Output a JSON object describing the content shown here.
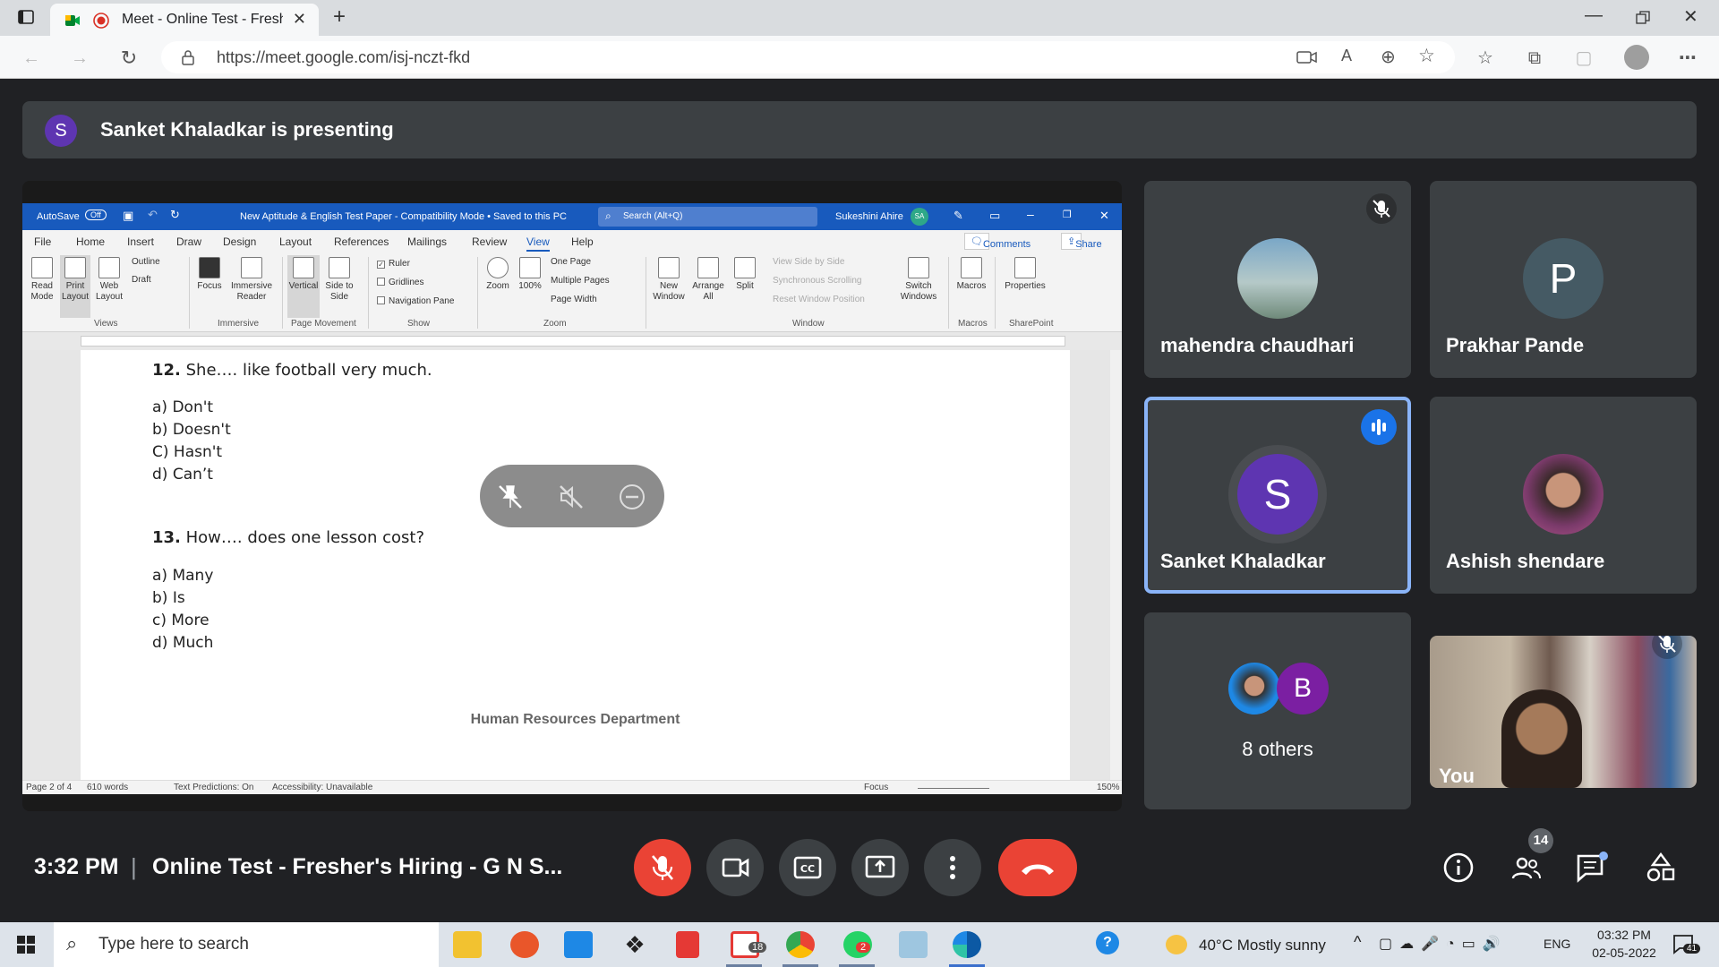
{
  "browser": {
    "tab_title": "Meet - Online Test - Fresher",
    "url": "https://meet.google.com/isj-nczt-fkd"
  },
  "presenting": {
    "avatar_letter": "S",
    "text": "Sanket Khaladkar is presenting"
  },
  "word": {
    "autosave": "AutoSave",
    "autosave_state": "Off",
    "doc_title": "New Aptitude & English Test Paper  -  Compatibility Mode • Saved to this PC",
    "search_placeholder": "Search (Alt+Q)",
    "user": "Sukeshini Ahire",
    "user_initials": "SA",
    "tabs": [
      "File",
      "Home",
      "Insert",
      "Draw",
      "Design",
      "Layout",
      "References",
      "Mailings",
      "Review",
      "View",
      "Help"
    ],
    "comments": "Comments",
    "share": "Share",
    "ribbon": {
      "read_mode": "Read Mode",
      "print_layout": "Print Layout",
      "web_layout": "Web Layout",
      "outline": "Outline",
      "draft": "Draft",
      "focus": "Focus",
      "immersive_reader": "Immersive Reader",
      "vertical": "Vertical",
      "side_to_side": "Side to Side",
      "ruler": "Ruler",
      "gridlines": "Gridlines",
      "navigation_pane": "Navigation Pane",
      "zoom": "Zoom",
      "zoom100": "100%",
      "one_page": "One Page",
      "multiple_pages": "Multiple Pages",
      "page_width": "Page Width",
      "new_window": "New Window",
      "arrange_all": "Arrange All",
      "split": "Split",
      "view_side_by_side": "View Side by Side",
      "sync_scroll": "Synchronous Scrolling",
      "reset_window": "Reset Window Position",
      "switch_windows": "Switch Windows",
      "macros": "Macros",
      "properties": "Properties",
      "groups": [
        "Views",
        "Immersive",
        "Page Movement",
        "Show",
        "Zoom",
        "Window",
        "Macros",
        "SharePoint"
      ]
    },
    "document": {
      "q12_num": "12.",
      "q12_text": "She…. like football very much.",
      "q12_options": [
        "a) Don't",
        "b) Doesn't",
        "C) Hasn't",
        "d) Can’t"
      ],
      "q13_num": "13.",
      "q13_text": "How…. does one lesson cost?",
      "q13_options": [
        "a) Many",
        "b) Is",
        "c) More",
        "d) Much"
      ],
      "footer": "Human Resources Department"
    },
    "status": {
      "page": "Page 2 of 4",
      "words": "610 words",
      "predictions": "Text Predictions: On",
      "accessibility": "Accessibility: Unavailable",
      "focus": "Focus",
      "zoom": "150%"
    }
  },
  "participants": [
    {
      "name": "mahendra chaudhari"
    },
    {
      "name": "Prakhar Pande",
      "letter": "P"
    },
    {
      "name": "Sanket Khaladkar",
      "letter": "S"
    },
    {
      "name": "Ashish shendare"
    },
    {
      "name": "8 others",
      "letter": "B"
    },
    {
      "name": "You"
    }
  ],
  "meetbar": {
    "time": "3:32 PM",
    "separator": "|",
    "meeting_name": "Online Test - Fresher's Hiring - G N S...",
    "people_count": "14"
  },
  "taskbar": {
    "search_placeholder": "Type here to search",
    "gmail_badge": "18",
    "whatsapp_badge": "2",
    "weather": "40°C  Mostly sunny",
    "lang": "ENG",
    "time": "03:32 PM",
    "date": "02-05-2022",
    "notif_count": "41"
  },
  "colors": {
    "meet_bg": "#202124",
    "tile_bg": "#3c4043",
    "word_blue": "#185abd",
    "end_call_red": "#ea4335",
    "accent_blue": "#1a73e8",
    "avatar_purple": "#5e35b1",
    "avatar_gray": "#455a64"
  }
}
